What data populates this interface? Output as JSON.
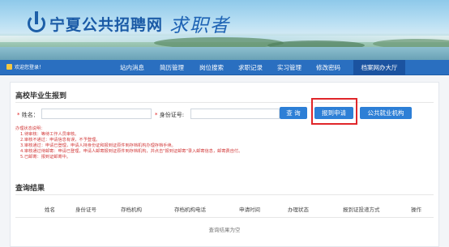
{
  "site": {
    "title": "宁夏公共招聘网",
    "subtitle": "求职者"
  },
  "nav": {
    "welcome": "欢迎您登录！",
    "items": [
      "站内消息",
      "简历管理",
      "岗位搜索",
      "求职记录",
      "实习管理",
      "修改密码",
      "档案网办大厅"
    ],
    "active_index": 6
  },
  "form": {
    "section_title": "高校毕业生报到",
    "name_label": "姓名：",
    "name_value": "",
    "id_label": "身份证号:",
    "id_value": "",
    "search_button": "查 询",
    "report_button": "报到申请",
    "agency_button": "公共就业机构"
  },
  "notes": [
    "办理状态说明：",
    "1.待审核：等待工作人员审核。",
    "2.审核不通过：申请信息有误，不予登理。",
    "3.审核通过：申请已登理，申请人持身份证和报到证原件到存档机构办理存档手续。",
    "4.审核通过待邮寄：申请已登理，申请人邮寄报到证原件到存档机构，并点击\"报到证邮寄\"录入邮寄信息，邮寄费自付。",
    "5.已邮寄：报到证邮寄中。"
  ],
  "results": {
    "section_title": "查询结果",
    "columns": [
      "姓名",
      "身份证号",
      "存档机构",
      "存档机构电话",
      "申请时间",
      "办理状态",
      "报到证投递方式",
      "操作"
    ],
    "empty_text": "查询结果为空"
  },
  "colors": {
    "nav_bg": "#2a6fc0",
    "button_bg": "#2d7fd6",
    "highlight": "#e0262a",
    "note_text": "#d23b3b"
  }
}
